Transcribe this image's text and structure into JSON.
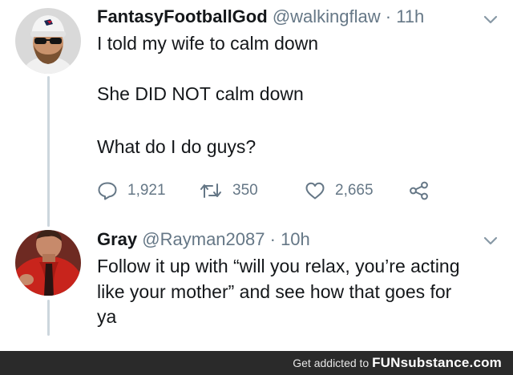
{
  "tweets": [
    {
      "display_name": "FantasyFootballGod",
      "handle": "@walkingflaw",
      "separator": "·",
      "time": "11h",
      "avatar_icon": "profile-photo",
      "lines": [
        "I told my wife to calm down",
        "She DID NOT calm down",
        "What do I do guys?"
      ],
      "actions": {
        "reply_count": "1,921",
        "retweet_count": "350",
        "like_count": "2,665"
      }
    },
    {
      "display_name": "Gray",
      "handle": "@Rayman2087",
      "separator": "·",
      "time": "10h",
      "avatar_icon": "profile-photo",
      "lines": [
        "Follow it up with “will you relax, you’re acting",
        "like your mother” and see how that goes for",
        "ya"
      ]
    }
  ],
  "colors": {
    "primary_text": "#14171a",
    "secondary_text": "#657786",
    "thread_line": "#ccd6dd",
    "banner_background": "#2a2a2a"
  },
  "banner": {
    "text": "Get addicted to",
    "brand": "FUNsubstance.com"
  }
}
